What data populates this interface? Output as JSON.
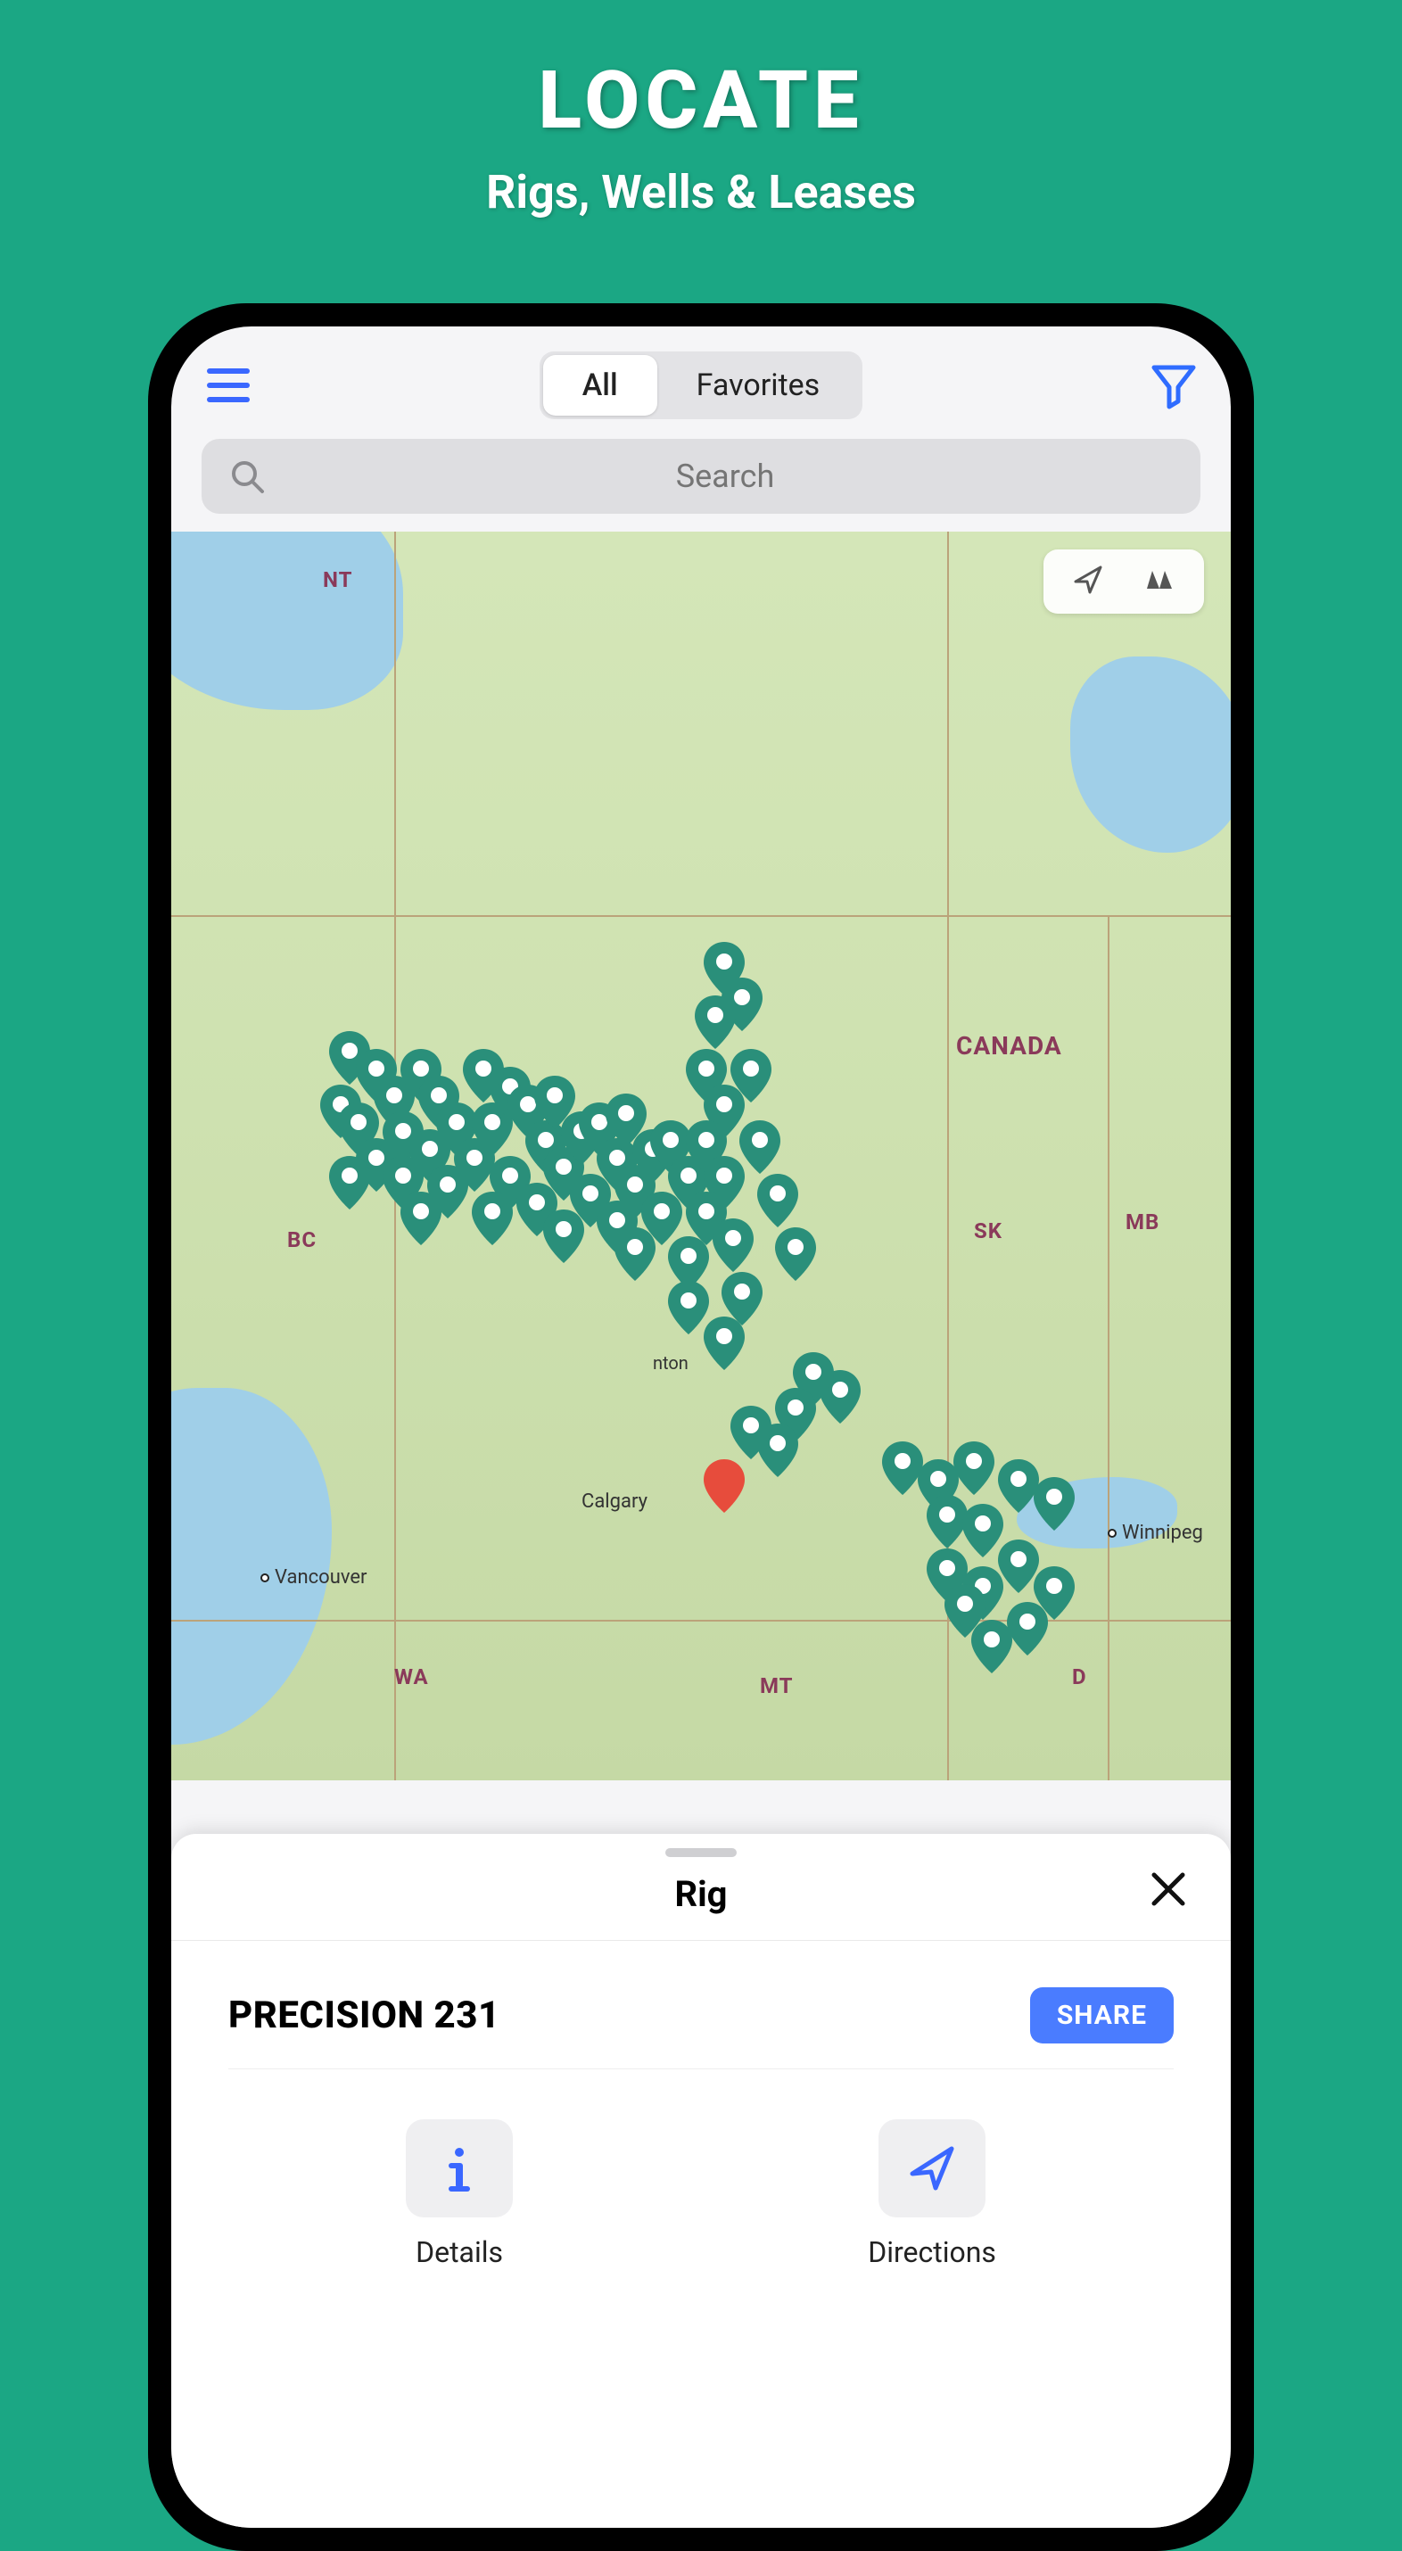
{
  "promo": {
    "title": "LOCATE",
    "subtitle": "Rigs, Wells & Leases"
  },
  "topbar": {
    "segments": {
      "all": "All",
      "favorites": "Favorites"
    }
  },
  "search": {
    "placeholder": "Search"
  },
  "map": {
    "labels": {
      "nt": "NT",
      "canada": "CANADA",
      "bc": "BC",
      "sk": "SK",
      "mb": "MB",
      "wa": "WA",
      "mt": "MT",
      "nd": "D"
    },
    "cities": {
      "vancouver": "Vancouver",
      "calgary": "Calgary",
      "winnipeg": "Winnipeg",
      "edmonton": "nton"
    }
  },
  "sheet": {
    "title": "Rig",
    "rig_name": "PRECISION 231",
    "share": "SHARE",
    "details": "Details",
    "directions": "Directions"
  },
  "colors": {
    "accent": "#4a7cff",
    "pin": "#2a8f7a",
    "selected_pin": "#e74c3c",
    "bg": "#1ba784"
  }
}
